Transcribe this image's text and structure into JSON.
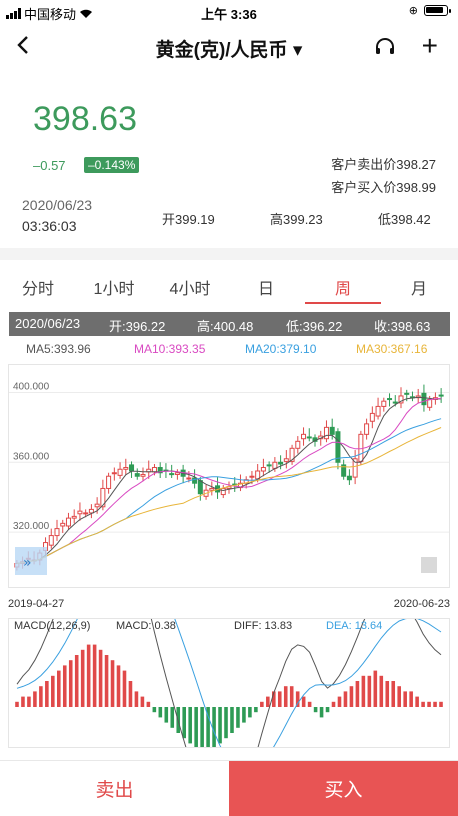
{
  "status": {
    "carrier": "中国移动",
    "time": "上午 3:36"
  },
  "nav": {
    "title": "黄金(克)/人民币 ▾",
    "back_icon": "chevron-left-icon",
    "service_icon": "headset-icon",
    "add_icon": "plus-icon"
  },
  "quote": {
    "price": "398.63",
    "change": "–0.57",
    "change_pct": "–0.143%",
    "sell_price": "客户卖出价398.27",
    "buy_price": "客户买入价398.99",
    "date": "2020/06/23",
    "time": "03:36:03",
    "open": "开399.19",
    "high": "高399.23",
    "low": "低398.42"
  },
  "tabs": [
    {
      "label": "分时",
      "active": false
    },
    {
      "label": "1小时",
      "active": false
    },
    {
      "label": "4小时",
      "active": false
    },
    {
      "label": "日",
      "active": false
    },
    {
      "label": "周",
      "active": true
    },
    {
      "label": "月",
      "active": false
    }
  ],
  "info": {
    "date": "2020/06/23",
    "open": "开:396.22",
    "high": "高:400.48",
    "low": "低:396.22",
    "close": "收:398.63"
  },
  "ma": {
    "ma5": "MA5:393.96",
    "ma10": "MA10:393.35",
    "ma20": "MA20:379.10",
    "ma30": "MA30:367.16"
  },
  "colors": {
    "up": "#e04949",
    "down": "#2e9b55",
    "ma5": "#555555",
    "ma10": "#d94ac2",
    "ma20": "#3aa0e0",
    "ma30": "#e8b53a",
    "accent": "#e04949",
    "price_green": "#3d9a5c"
  },
  "chart_data": {
    "type": "candlestick",
    "y_ticks": [
      "400.000",
      "360.000",
      "320.000"
    ],
    "x_start": "2019-04-27",
    "x_end": "2020-06-23",
    "ylim": [
      300,
      410
    ],
    "closes": [
      302,
      303,
      305,
      304,
      308,
      314,
      318,
      322,
      325,
      328,
      329,
      332,
      331,
      333,
      336,
      345,
      352,
      354,
      356,
      357,
      355,
      352,
      353,
      356,
      357,
      354,
      355,
      353,
      354,
      352,
      351,
      348,
      342,
      344,
      345,
      343,
      345,
      346,
      347,
      348,
      350,
      352,
      355,
      357,
      358,
      360,
      359,
      362,
      368,
      372,
      376,
      374,
      372,
      375,
      380,
      376,
      360,
      352,
      350,
      362,
      376,
      382,
      388,
      392,
      395,
      396,
      394,
      398,
      399,
      397,
      398,
      393,
      396,
      397,
      398
    ],
    "macd": {
      "label": "MACD(12,26,9)",
      "macd_value": "MACD: 0.38",
      "diff": "DIFF: 13.83",
      "dea": "DEA: 13.64",
      "hist": [
        1,
        2,
        2,
        3,
        4,
        5,
        6,
        7,
        8,
        9,
        10,
        11,
        12,
        12,
        11,
        10,
        9,
        8,
        7,
        5,
        3,
        2,
        1,
        -1,
        -2,
        -3,
        -4,
        -5,
        -6,
        -7,
        -8,
        -9,
        -9,
        -8,
        -7,
        -6,
        -5,
        -4,
        -3,
        -2,
        -1,
        1,
        2,
        3,
        3,
        4,
        4,
        3,
        2,
        1,
        -1,
        -2,
        -1,
        1,
        2,
        3,
        4,
        5,
        6,
        6,
        7,
        6,
        5,
        5,
        4,
        3,
        3,
        2,
        1,
        1,
        1,
        1
      ]
    }
  },
  "bottom": {
    "sell_label": "卖出",
    "buy_label": "买入"
  }
}
